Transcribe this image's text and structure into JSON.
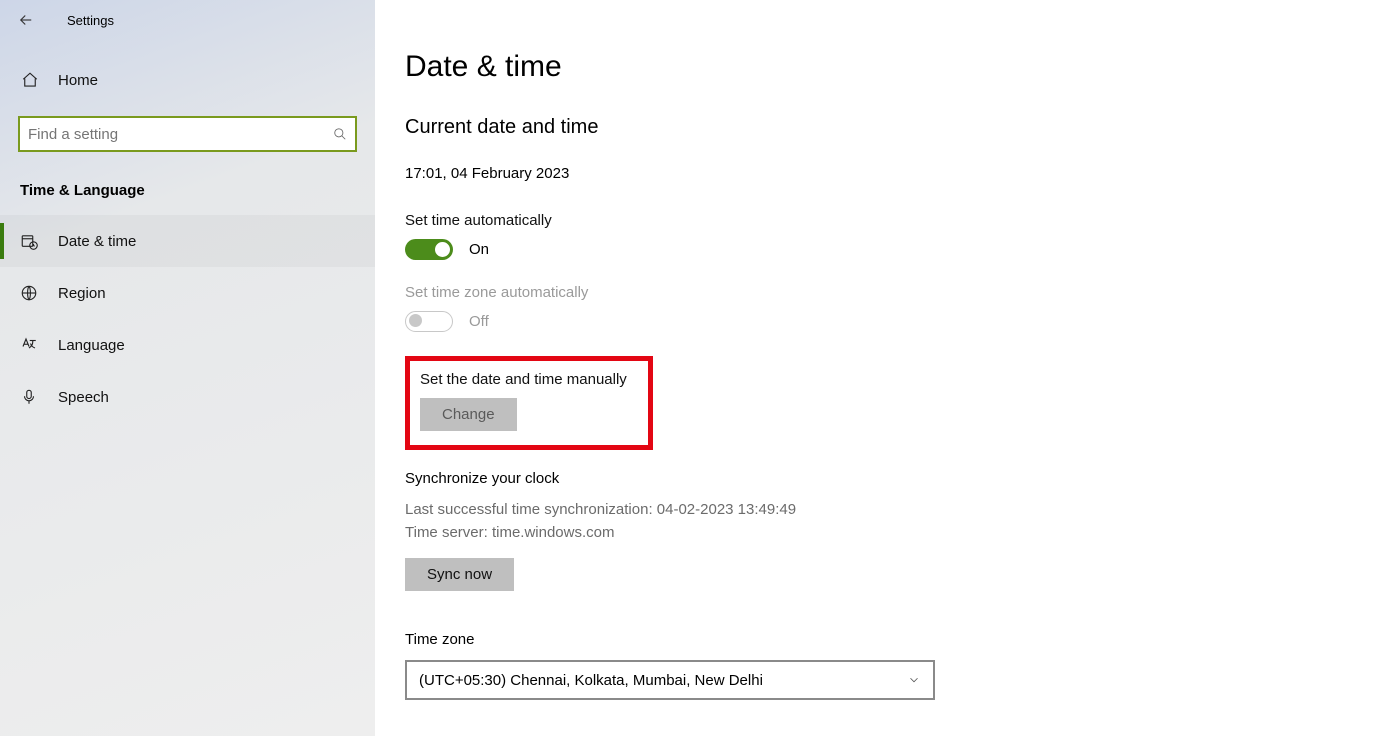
{
  "header": {
    "app_title": "Settings"
  },
  "sidebar": {
    "home_label": "Home",
    "search_placeholder": "Find a setting",
    "category_title": "Time & Language",
    "items": [
      {
        "label": "Date & time",
        "icon": "calendar-clock-icon",
        "active": true
      },
      {
        "label": "Region",
        "icon": "globe-icon",
        "active": false
      },
      {
        "label": "Language",
        "icon": "language-icon",
        "active": false
      },
      {
        "label": "Speech",
        "icon": "microphone-icon",
        "active": false
      }
    ]
  },
  "main": {
    "page_title": "Date & time",
    "current_section_title": "Current date and time",
    "current_datetime": "17:01, 04 February 2023",
    "auto_time": {
      "label": "Set time automatically",
      "state_text": "On",
      "on": true
    },
    "auto_tz": {
      "label": "Set time zone automatically",
      "state_text": "Off",
      "on": false,
      "disabled": true
    },
    "manual": {
      "label": "Set the date and time manually",
      "button_label": "Change"
    },
    "sync": {
      "title": "Synchronize your clock",
      "last_sync_line": "Last successful time synchronization: 04-02-2023 13:49:49",
      "server_line": "Time server: time.windows.com",
      "button_label": "Sync now"
    },
    "timezone": {
      "label": "Time zone",
      "selected": "(UTC+05:30) Chennai, Kolkata, Mumbai, New Delhi"
    }
  }
}
